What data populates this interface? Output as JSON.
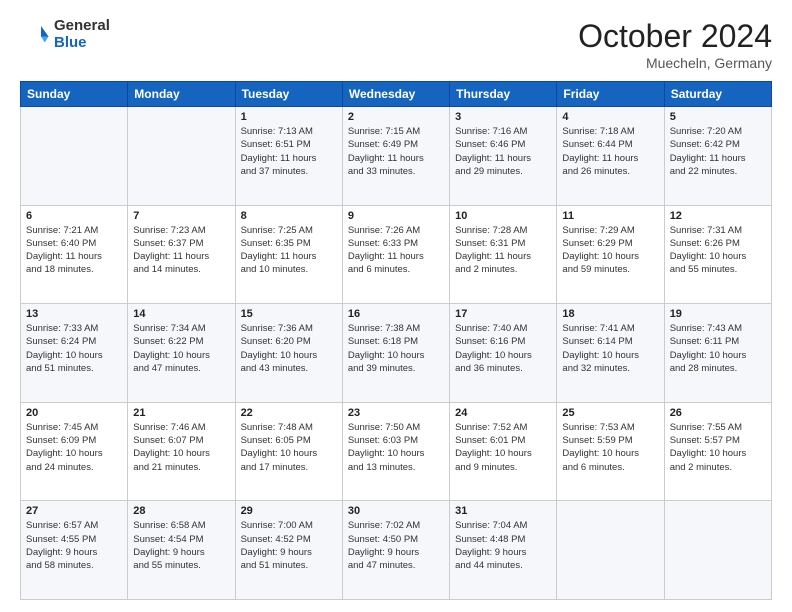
{
  "logo": {
    "general": "General",
    "blue": "Blue"
  },
  "header": {
    "month": "October 2024",
    "location": "Muecheln, Germany"
  },
  "weekdays": [
    "Sunday",
    "Monday",
    "Tuesday",
    "Wednesday",
    "Thursday",
    "Friday",
    "Saturday"
  ],
  "weeks": [
    [
      {
        "day": "",
        "info": ""
      },
      {
        "day": "",
        "info": ""
      },
      {
        "day": "1",
        "info": "Sunrise: 7:13 AM\nSunset: 6:51 PM\nDaylight: 11 hours\nand 37 minutes."
      },
      {
        "day": "2",
        "info": "Sunrise: 7:15 AM\nSunset: 6:49 PM\nDaylight: 11 hours\nand 33 minutes."
      },
      {
        "day": "3",
        "info": "Sunrise: 7:16 AM\nSunset: 6:46 PM\nDaylight: 11 hours\nand 29 minutes."
      },
      {
        "day": "4",
        "info": "Sunrise: 7:18 AM\nSunset: 6:44 PM\nDaylight: 11 hours\nand 26 minutes."
      },
      {
        "day": "5",
        "info": "Sunrise: 7:20 AM\nSunset: 6:42 PM\nDaylight: 11 hours\nand 22 minutes."
      }
    ],
    [
      {
        "day": "6",
        "info": "Sunrise: 7:21 AM\nSunset: 6:40 PM\nDaylight: 11 hours\nand 18 minutes."
      },
      {
        "day": "7",
        "info": "Sunrise: 7:23 AM\nSunset: 6:37 PM\nDaylight: 11 hours\nand 14 minutes."
      },
      {
        "day": "8",
        "info": "Sunrise: 7:25 AM\nSunset: 6:35 PM\nDaylight: 11 hours\nand 10 minutes."
      },
      {
        "day": "9",
        "info": "Sunrise: 7:26 AM\nSunset: 6:33 PM\nDaylight: 11 hours\nand 6 minutes."
      },
      {
        "day": "10",
        "info": "Sunrise: 7:28 AM\nSunset: 6:31 PM\nDaylight: 11 hours\nand 2 minutes."
      },
      {
        "day": "11",
        "info": "Sunrise: 7:29 AM\nSunset: 6:29 PM\nDaylight: 10 hours\nand 59 minutes."
      },
      {
        "day": "12",
        "info": "Sunrise: 7:31 AM\nSunset: 6:26 PM\nDaylight: 10 hours\nand 55 minutes."
      }
    ],
    [
      {
        "day": "13",
        "info": "Sunrise: 7:33 AM\nSunset: 6:24 PM\nDaylight: 10 hours\nand 51 minutes."
      },
      {
        "day": "14",
        "info": "Sunrise: 7:34 AM\nSunset: 6:22 PM\nDaylight: 10 hours\nand 47 minutes."
      },
      {
        "day": "15",
        "info": "Sunrise: 7:36 AM\nSunset: 6:20 PM\nDaylight: 10 hours\nand 43 minutes."
      },
      {
        "day": "16",
        "info": "Sunrise: 7:38 AM\nSunset: 6:18 PM\nDaylight: 10 hours\nand 39 minutes."
      },
      {
        "day": "17",
        "info": "Sunrise: 7:40 AM\nSunset: 6:16 PM\nDaylight: 10 hours\nand 36 minutes."
      },
      {
        "day": "18",
        "info": "Sunrise: 7:41 AM\nSunset: 6:14 PM\nDaylight: 10 hours\nand 32 minutes."
      },
      {
        "day": "19",
        "info": "Sunrise: 7:43 AM\nSunset: 6:11 PM\nDaylight: 10 hours\nand 28 minutes."
      }
    ],
    [
      {
        "day": "20",
        "info": "Sunrise: 7:45 AM\nSunset: 6:09 PM\nDaylight: 10 hours\nand 24 minutes."
      },
      {
        "day": "21",
        "info": "Sunrise: 7:46 AM\nSunset: 6:07 PM\nDaylight: 10 hours\nand 21 minutes."
      },
      {
        "day": "22",
        "info": "Sunrise: 7:48 AM\nSunset: 6:05 PM\nDaylight: 10 hours\nand 17 minutes."
      },
      {
        "day": "23",
        "info": "Sunrise: 7:50 AM\nSunset: 6:03 PM\nDaylight: 10 hours\nand 13 minutes."
      },
      {
        "day": "24",
        "info": "Sunrise: 7:52 AM\nSunset: 6:01 PM\nDaylight: 10 hours\nand 9 minutes."
      },
      {
        "day": "25",
        "info": "Sunrise: 7:53 AM\nSunset: 5:59 PM\nDaylight: 10 hours\nand 6 minutes."
      },
      {
        "day": "26",
        "info": "Sunrise: 7:55 AM\nSunset: 5:57 PM\nDaylight: 10 hours\nand 2 minutes."
      }
    ],
    [
      {
        "day": "27",
        "info": "Sunrise: 6:57 AM\nSunset: 4:55 PM\nDaylight: 9 hours\nand 58 minutes."
      },
      {
        "day": "28",
        "info": "Sunrise: 6:58 AM\nSunset: 4:54 PM\nDaylight: 9 hours\nand 55 minutes."
      },
      {
        "day": "29",
        "info": "Sunrise: 7:00 AM\nSunset: 4:52 PM\nDaylight: 9 hours\nand 51 minutes."
      },
      {
        "day": "30",
        "info": "Sunrise: 7:02 AM\nSunset: 4:50 PM\nDaylight: 9 hours\nand 47 minutes."
      },
      {
        "day": "31",
        "info": "Sunrise: 7:04 AM\nSunset: 4:48 PM\nDaylight: 9 hours\nand 44 minutes."
      },
      {
        "day": "",
        "info": ""
      },
      {
        "day": "",
        "info": ""
      }
    ]
  ]
}
